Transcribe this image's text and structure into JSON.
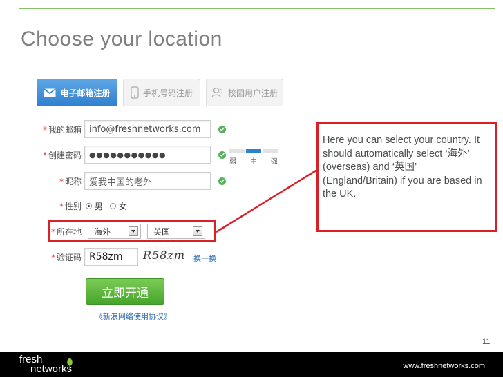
{
  "slide": {
    "title": "Choose your location",
    "page_number": "11"
  },
  "tabs": [
    {
      "label": "电子邮箱注册",
      "icon": "envelope-icon",
      "active": true
    },
    {
      "label": "手机号码注册",
      "icon": "phone-icon",
      "active": false
    },
    {
      "label": "校园用户注册",
      "icon": "user-group-icon",
      "active": false
    }
  ],
  "form": {
    "email": {
      "label": "我的邮箱",
      "value": "info@freshnetworks.com"
    },
    "password": {
      "label": "创建密码",
      "value": "●●●●●●●●●●●"
    },
    "strength": {
      "weak": "弱",
      "medium": "中",
      "strong": "强",
      "level": 2
    },
    "nickname": {
      "label": "昵称",
      "value": "爱我中国的老外"
    },
    "gender": {
      "label": "性别",
      "male": "男",
      "female": "女",
      "selected": "male"
    },
    "location": {
      "label": "所在地",
      "region": "海外",
      "country": "英国"
    },
    "captcha": {
      "label": "验证码",
      "value": "R58zm",
      "image_text": "R58zm",
      "refresh": "换一换"
    },
    "submit_label": "立即开通",
    "agreement": "《新浪网络使用协议》"
  },
  "callout": {
    "text": "Here you can select your country. It should automatically select ‘海外’ (overseas) and ‘英国’ (England/Britain) if you are based in the UK."
  },
  "footer": {
    "brand_line1": "fresh",
    "brand_line2": "networks",
    "url": "www.freshnetworks.com"
  },
  "colors": {
    "accent_blue": "#2f80cf",
    "highlight_red": "#d92027",
    "submit_green": "#46a52c",
    "rule_green": "#86c06b"
  }
}
